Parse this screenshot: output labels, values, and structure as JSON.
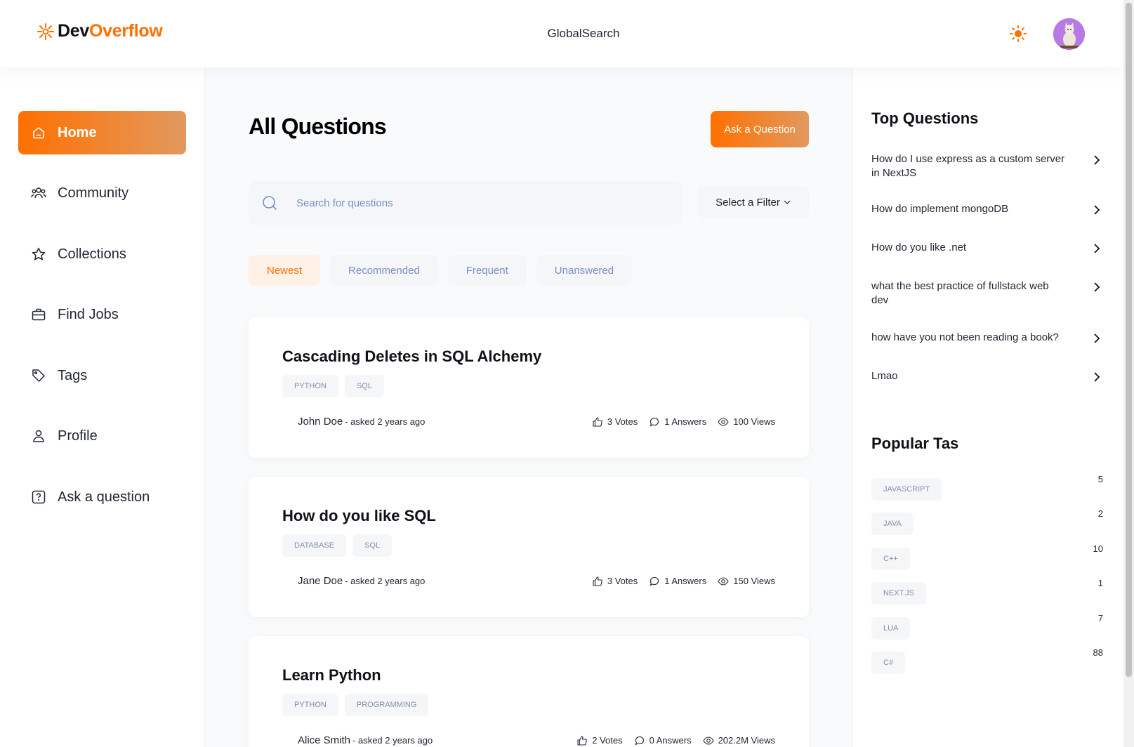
{
  "header": {
    "brand_part1": "Dev",
    "brand_part2": "Overflow",
    "global_search": "GlobalSearch",
    "theme_icon": "sun-icon",
    "accent_color": "#ff7000"
  },
  "sidebar": {
    "items": [
      {
        "label": "Home",
        "icon": "home-icon",
        "active": true
      },
      {
        "label": "Community",
        "icon": "users-icon"
      },
      {
        "label": "Collections",
        "icon": "star-icon"
      },
      {
        "label": "Find Jobs",
        "icon": "briefcase-icon"
      },
      {
        "label": "Tags",
        "icon": "tag-icon"
      },
      {
        "label": "Profile",
        "icon": "user-icon"
      },
      {
        "label": "Ask a question",
        "icon": "question-icon"
      }
    ]
  },
  "main": {
    "title": "All Questions",
    "ask_button": "Ask a Question",
    "search_placeholder": "Search for questions",
    "filter_label": "Select a Filter",
    "tabs": [
      {
        "label": "Newest",
        "active": true
      },
      {
        "label": "Recommended"
      },
      {
        "label": "Frequent"
      },
      {
        "label": "Unanswered"
      }
    ],
    "questions": [
      {
        "title": "Cascading Deletes in SQL Alchemy",
        "tags": [
          "PYTHON",
          "SQL"
        ],
        "author": "John Doe",
        "asked": "- asked 2 years ago",
        "votes": "3 Votes",
        "answers": "1 Answers",
        "views": "100 Views"
      },
      {
        "title": "How do you like SQL",
        "tags": [
          "DATABASE",
          "SQL"
        ],
        "author": "Jane Doe",
        "asked": "- asked 2 years ago",
        "votes": "3 Votes",
        "answers": "1 Answers",
        "views": "150 Views"
      },
      {
        "title": "Learn Python",
        "tags": [
          "PYTHON",
          "PROGRAMMING"
        ],
        "author": "Alice Smith",
        "asked": "- asked 2 years ago",
        "votes": "2 Votes",
        "answers": "0 Answers",
        "views": "202.2M Views"
      }
    ]
  },
  "right_sidebar": {
    "top_questions_title": "Top Questions",
    "top_questions": [
      "How do I use express as a custom server in NextJS",
      "How do implement mongoDB",
      "How do you like .net",
      "what the best practice of fullstack web dev",
      "how have you not been reading a book?",
      "Lmao"
    ],
    "popular_tags_title": "Popular Tas",
    "popular_tags": [
      {
        "name": "JAVASCRIPT",
        "count": "5"
      },
      {
        "name": "JAVA",
        "count": "2"
      },
      {
        "name": "C++",
        "count": "10"
      },
      {
        "name": "NEXT.JS",
        "count": "1"
      },
      {
        "name": "LUA",
        "count": "7"
      },
      {
        "name": "C#",
        "count": "88"
      }
    ]
  }
}
